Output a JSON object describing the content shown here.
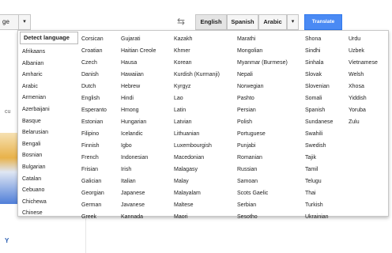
{
  "toolbar": {
    "source_value": "ge",
    "source_arrow": "▾",
    "swap_glyph": "⇆",
    "target_tabs": [
      "English",
      "Spanish",
      "Arabic"
    ],
    "target_arrow": "▾",
    "translate_label": "Translate"
  },
  "background": {
    "left_fragment": "cu",
    "bottom_fragment": "Y"
  },
  "dropdown": {
    "detect_label": "Detect language",
    "columns": [
      [
        "Afrikaans",
        "Albanian",
        "Amharic",
        "Arabic",
        "Armenian",
        "Azerbaijani",
        "Basque",
        "Belarusian",
        "Bengali",
        "Bosnian",
        "Bulgarian",
        "Catalan",
        "Cebuano",
        "Chichewa",
        "Chinese"
      ],
      [
        "Corsican",
        "Croatian",
        "Czech",
        "Danish",
        "Dutch",
        "English",
        "Esperanto",
        "Estonian",
        "Filipino",
        "Finnish",
        "French",
        "Frisian",
        "Galician",
        "Georgian",
        "German",
        "Greek"
      ],
      [
        "Gujarati",
        "Haitian Creole",
        "Hausa",
        "Hawaiian",
        "Hebrew",
        "Hindi",
        "Hmong",
        "Hungarian",
        "Icelandic",
        "Igbo",
        "Indonesian",
        "Irish",
        "Italian",
        "Japanese",
        "Javanese",
        "Kannada"
      ],
      [
        "Kazakh",
        "Khmer",
        "Korean",
        "Kurdish (Kurmanji)",
        "Kyrgyz",
        "Lao",
        "Latin",
        "Latvian",
        "Lithuanian",
        "Luxembourgish",
        "Macedonian",
        "Malagasy",
        "Malay",
        "Malayalam",
        "Maltese",
        "Maori"
      ],
      [
        "Marathi",
        "Mongolian",
        "Myanmar (Burmese)",
        "Nepali",
        "Norwegian",
        "Pashto",
        "Persian",
        "Polish",
        "Portuguese",
        "Punjabi",
        "Romanian",
        "Russian",
        "Samoan",
        "Scots Gaelic",
        "Serbian",
        "Sesotho"
      ],
      [
        "Shona",
        "Sindhi",
        "Sinhala",
        "Slovak",
        "Slovenian",
        "Somali",
        "Spanish",
        "Sundanese",
        "Swahili",
        "Swedish",
        "Tajik",
        "Tamil",
        "Telugu",
        "Thai",
        "Turkish",
        "Ukrainian"
      ],
      [
        "Urdu",
        "Uzbek",
        "Vietnamese",
        "Welsh",
        "Xhosa",
        "Yiddish",
        "Yoruba",
        "Zulu"
      ]
    ]
  }
}
